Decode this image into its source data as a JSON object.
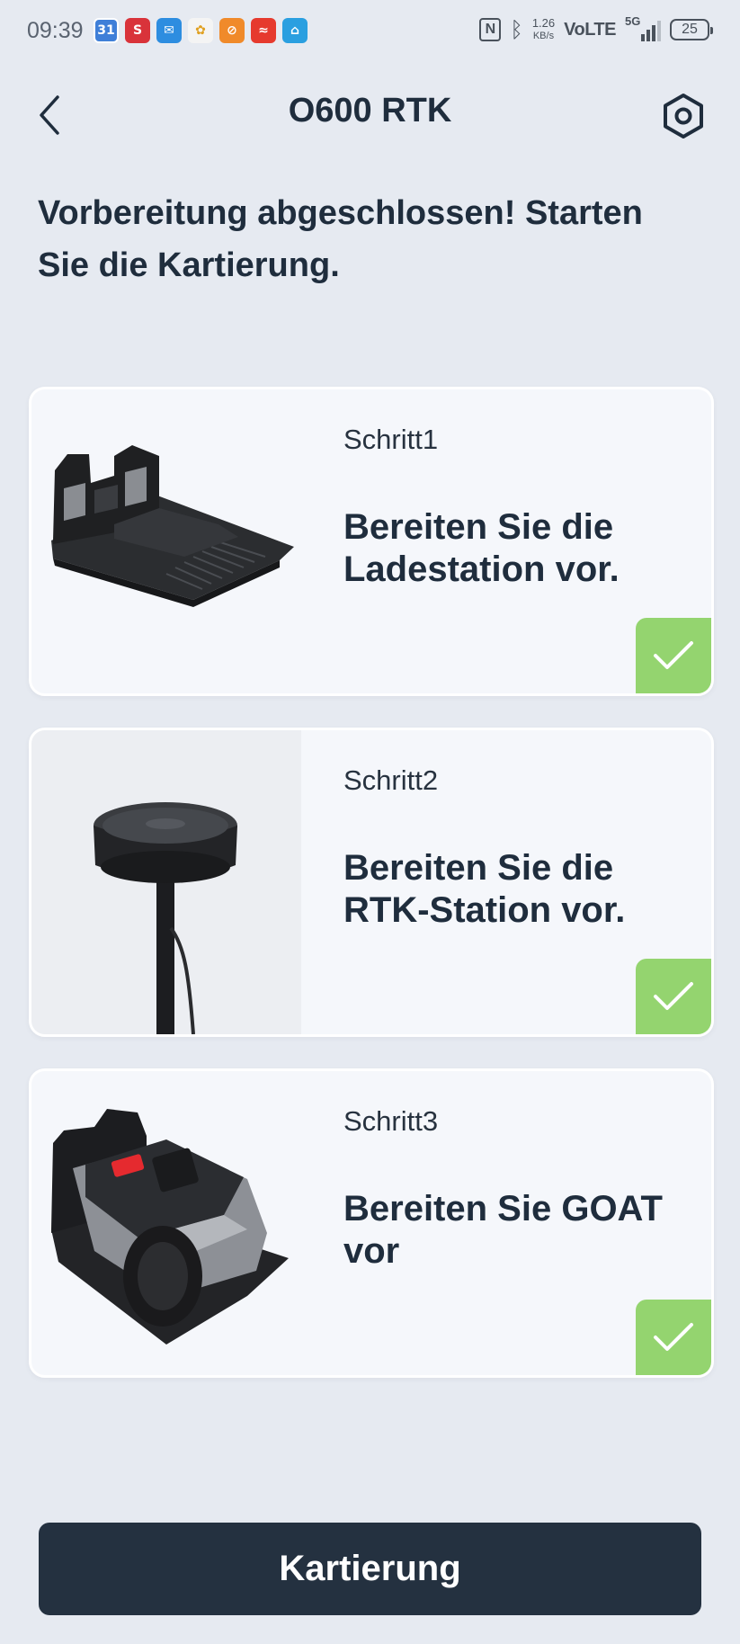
{
  "status_bar": {
    "time": "09:39",
    "apps": [
      {
        "name": "calendar-app-icon",
        "label": "31",
        "color": "#3f7fd8"
      },
      {
        "name": "s-app-icon",
        "label": "S",
        "color": "#d9333a"
      },
      {
        "name": "mail-app-icon",
        "label": "✉",
        "color": "#2d8de0"
      },
      {
        "name": "pinwheel-app-icon",
        "label": "✿",
        "color": "#f2f2f2"
      },
      {
        "name": "orange-app-icon",
        "label": "⊘",
        "color": "#f08a2a"
      },
      {
        "name": "red-app-icon",
        "label": "≈",
        "color": "#e63a2e"
      },
      {
        "name": "home-app-icon",
        "label": "⌂",
        "color": "#2a9fe0"
      }
    ],
    "nfc": "N",
    "speed_value": "1.26",
    "speed_unit": "KB/s",
    "volte": "VoLTE",
    "network": "5G",
    "battery": "25"
  },
  "header": {
    "title": "O600 RTK"
  },
  "headline": "Vorbereitung abgeschlossen! Starten Sie die Kartierung.",
  "steps": [
    {
      "step_label": "Schritt1",
      "text": "Bereiten Sie die Ladestation vor.",
      "image": "charging-station",
      "done": true
    },
    {
      "step_label": "Schritt2",
      "text": "Bereiten Sie die RTK-Station vor.",
      "image": "rtk-station",
      "done": true
    },
    {
      "step_label": "Schritt3",
      "text": "Bereiten Sie GOAT vor",
      "image": "robot-mower",
      "done": true
    }
  ],
  "primary_button": {
    "label": "Kartierung"
  },
  "colors": {
    "background": "#e6eaf1",
    "card": "#f5f7fb",
    "check": "#94d46f",
    "button": "#243140",
    "text": "#1f2d3d"
  }
}
